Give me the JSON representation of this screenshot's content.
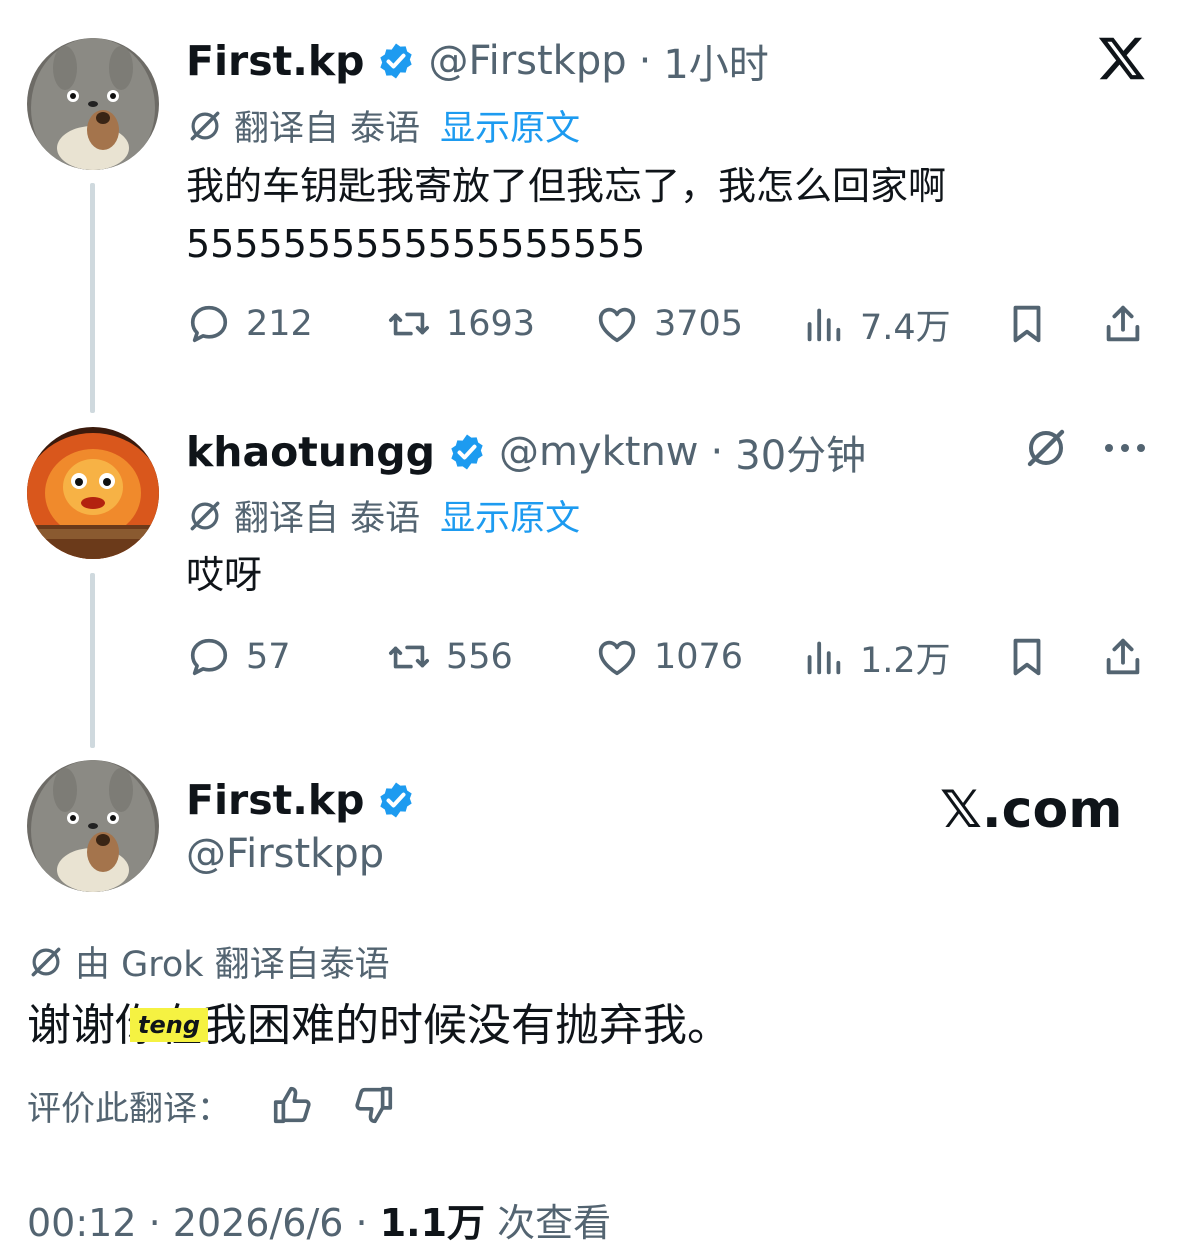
{
  "tweet1": {
    "name": "First.kp",
    "handle": "@Firstkpp",
    "time": "1小时",
    "translated_from": "翻译自 泰语",
    "show_original": "显示原文",
    "text_line1": "我的车钥匙我寄放了但我忘了，我怎么回家啊",
    "text_line2": "5555555555555555555",
    "replies": "212",
    "reposts": "1693",
    "likes": "3705",
    "views": "7.4万"
  },
  "tweet2": {
    "name": "khaotungg",
    "handle": "@myktnw",
    "time": "30分钟",
    "translated_from": "翻译自 泰语",
    "show_original": "显示原文",
    "text": "哎呀",
    "replies": "57",
    "reposts": "556",
    "likes": "1076",
    "views": "1.2万"
  },
  "tweet3": {
    "name": "First.kp",
    "handle": "@Firstkpp",
    "brand": "𝕏.com",
    "grok_translation": "由 Grok 翻译自泰语",
    "text": "谢谢你在我困难的时候没有抛弃我。",
    "sticker": "teng",
    "rate_translation": "评价此翻译：",
    "time": "00:12",
    "date": "2026/6/6",
    "views": "1.1万",
    "views_suffix": "次查看"
  },
  "colors": {
    "verified": "#1d9bf0",
    "link": "#1d9bf0",
    "muted": "#536471",
    "text": "#0f1419",
    "thread": "#cfd9de"
  },
  "icons": [
    "x-logo-icon",
    "verified-badge-icon",
    "translate-icon",
    "reply-icon",
    "retweet-icon",
    "like-icon",
    "views-icon",
    "bookmark-icon",
    "share-icon",
    "grok-icon",
    "more-icon",
    "thumbs-up-icon",
    "thumbs-down-icon"
  ]
}
